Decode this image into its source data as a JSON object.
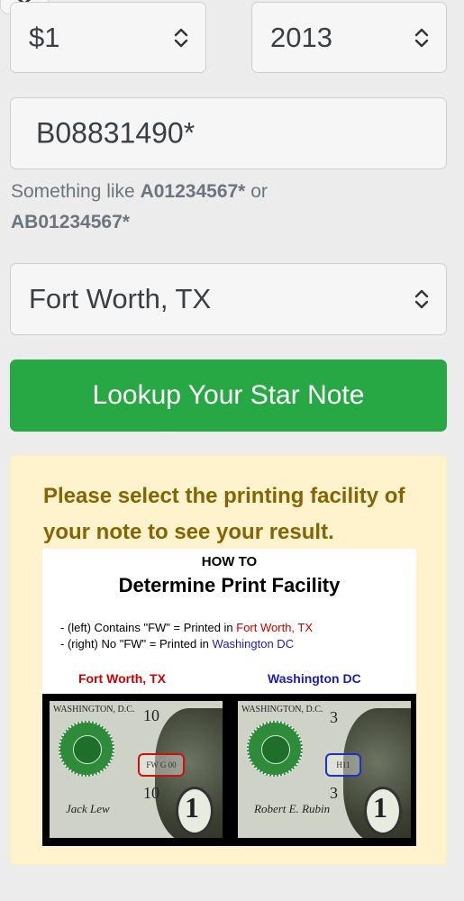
{
  "form": {
    "denomination": "$1",
    "year": "2013",
    "serial_value": "B08831490*",
    "hint_prefix": "Something like ",
    "hint_example1": "A01234567*",
    "hint_mid": " or",
    "hint_example2": "AB01234567*",
    "facility": "Fort Worth, TX",
    "submit_label": "Lookup Your Star Note"
  },
  "alert": {
    "message": "Please select the printing facility of your note to see your result."
  },
  "infographic": {
    "howto": "HOW TO",
    "title": "Determine Print Facility",
    "line1_prefix": "- (left) Contains \"FW\" = Printed in ",
    "line1_place": "Fort Worth, TX",
    "line2_prefix": "- (right) No \"FW\" = Printed in ",
    "line2_place": "Washington DC",
    "label_left": "Fort Worth, TX",
    "label_right": "Washington DC",
    "note_left": {
      "city": "WASHINGTON, D.C.",
      "number": "10",
      "number2": "10",
      "box": "FW G 00",
      "denomination": "1",
      "signature": "Jack Lew"
    },
    "note_right": {
      "city": "WASHINGTON, D.C.",
      "number": "3",
      "number2": "3",
      "box": "H11",
      "denomination": "1",
      "signature": "Robert E. Rubin"
    }
  },
  "colors": {
    "primary_button": "#28a745",
    "alert_bg": "#fff3cd",
    "alert_text": "#856404",
    "red_label": "#cc0000",
    "blue_label": "#1c1cab"
  },
  "icons": [
    "chevron-down-icon",
    "select-updown-icon"
  ]
}
